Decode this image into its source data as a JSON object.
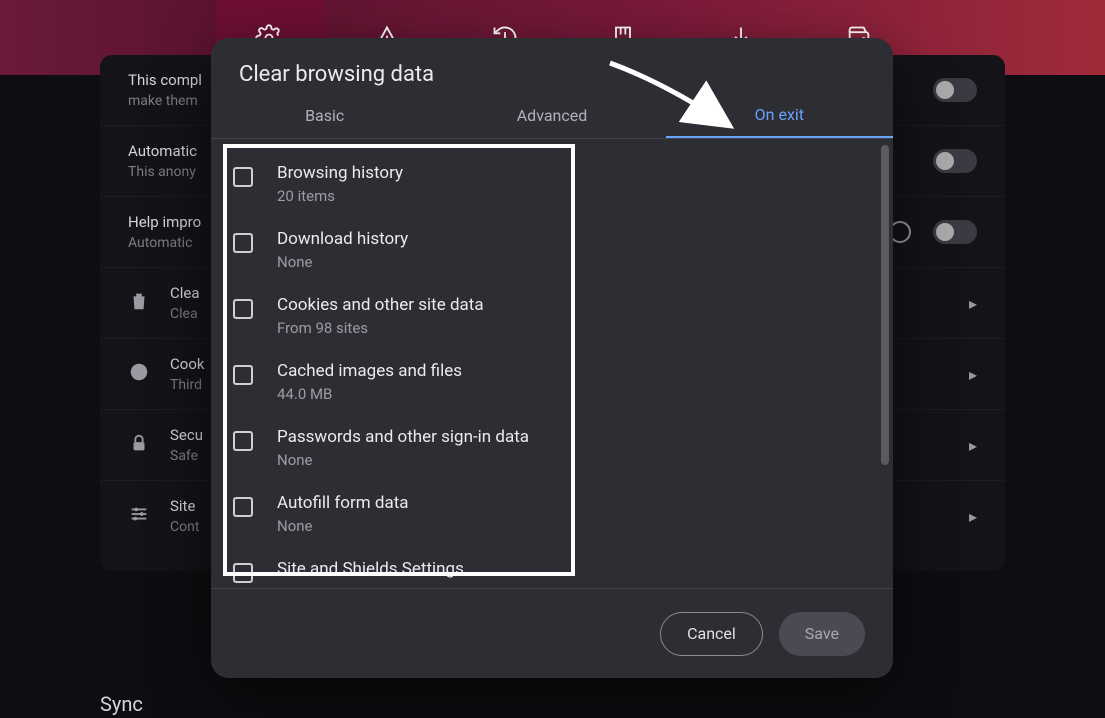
{
  "topbar": {
    "icons": [
      "gear-icon",
      "warning-icon",
      "history-icon",
      "bookmark-icon",
      "download-icon",
      "wallet-icon"
    ]
  },
  "background": {
    "row0": {
      "title": "This compl",
      "sub": "make them"
    },
    "row1": {
      "title": "Automatic",
      "sub": "This anony"
    },
    "row2": {
      "title": "Help impro",
      "sub": "Automatic"
    },
    "row3": {
      "title": "Clea",
      "sub": "Clea"
    },
    "row4": {
      "title": "Cook",
      "sub": "Third"
    },
    "row5": {
      "title": "Secu",
      "sub": "Safe"
    },
    "row6": {
      "title": "Site",
      "sub": "Cont"
    },
    "sync": "Sync"
  },
  "modal": {
    "title": "Clear browsing data",
    "tabs": {
      "basic": "Basic",
      "advanced": "Advanced",
      "on_exit": "On exit"
    },
    "options": [
      {
        "title": "Browsing history",
        "sub": "20 items"
      },
      {
        "title": "Download history",
        "sub": "None"
      },
      {
        "title": "Cookies and other site data",
        "sub": "From 98 sites"
      },
      {
        "title": "Cached images and files",
        "sub": "44.0 MB"
      },
      {
        "title": "Passwords and other sign-in data",
        "sub": "None"
      },
      {
        "title": "Autofill form data",
        "sub": "None"
      },
      {
        "title": "Site and Shields Settings",
        "sub": ""
      }
    ],
    "buttons": {
      "cancel": "Cancel",
      "save": "Save"
    }
  }
}
